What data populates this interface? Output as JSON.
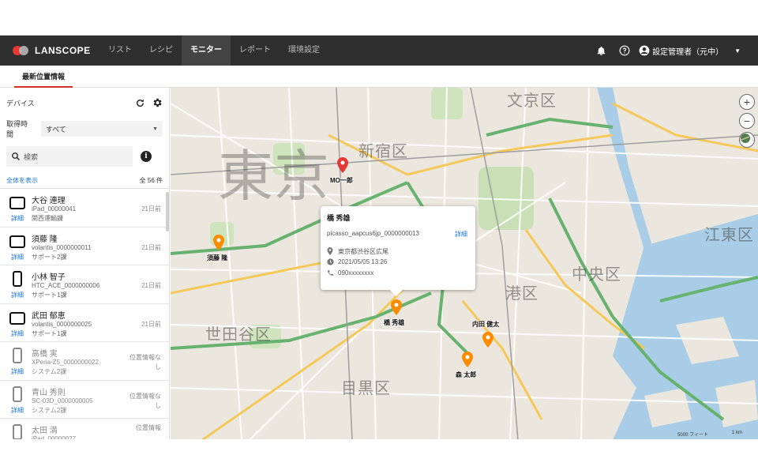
{
  "brand": {
    "name": "LANSCOPE"
  },
  "nav": {
    "items": [
      {
        "label": "リスト",
        "active": false
      },
      {
        "label": "レシピ",
        "active": false
      },
      {
        "label": "モニター",
        "active": true
      },
      {
        "label": "レポート",
        "active": false
      },
      {
        "label": "環境設定",
        "active": false
      }
    ],
    "user_label": "設定管理者（元中）",
    "icons": [
      "bell-icon",
      "help-icon",
      "user-icon"
    ]
  },
  "subtab": {
    "label": "最新位置情報"
  },
  "sidebar": {
    "title": "デバイス",
    "filter_label": "取得時間",
    "filter_value": "すべて",
    "search_placeholder": "検索",
    "show_all": "全体を表示",
    "total": "全 56 件",
    "detail_label": "詳細",
    "devices": [
      {
        "name": "大谷 連理",
        "id": "iPad_00000041",
        "group": "関西運輸課",
        "time": "21日前",
        "type": "tablet"
      },
      {
        "name": "須藤 隆",
        "id": "volantis_0000000011",
        "group": "サポート2課",
        "time": "21日前",
        "type": "tablet"
      },
      {
        "name": "小林 智子",
        "id": "HTC_ACE_0000000006",
        "group": "サポート1課",
        "time": "21日前",
        "type": "phone"
      },
      {
        "name": "武田 郁恵",
        "id": "volantis_0000000025",
        "group": "サポート1課",
        "time": "21日前",
        "type": "tablet"
      },
      {
        "name": "高橋 実",
        "id": "XPeria-Z5_0000000022",
        "group": "システム2課",
        "time": "位置情報なし",
        "type": "phone"
      },
      {
        "name": "青山 秀則",
        "id": "SC-03D_0000000005",
        "group": "システム2課",
        "time": "位置情報なし",
        "type": "phone"
      },
      {
        "name": "太田 満",
        "id": "iPad_00000027",
        "group": "",
        "time": "位置情報",
        "type": "phone"
      }
    ]
  },
  "map": {
    "wards": [
      "東京",
      "新宿区",
      "文京区",
      "江東区",
      "中央区",
      "港区",
      "世田谷区",
      "目黒区"
    ],
    "pins": [
      {
        "label": "MO一郎",
        "color": "#e53935"
      },
      {
        "label": "須藤 隆",
        "color": "#fb8c00"
      },
      {
        "label": "橋 秀雄",
        "color": "#fb8c00"
      },
      {
        "label": "内田 健太",
        "color": "#fb8c00"
      },
      {
        "label": "森 太郎",
        "color": "#fb8c00"
      }
    ],
    "popup": {
      "name": "橋 秀雄",
      "device_id": "picasso_aapcus6jp_0000000013",
      "detail": "詳細",
      "address": "東京都渋谷区広尾",
      "datetime": "2021/05/05 13:26",
      "phone": "090xxxxxxxx"
    },
    "scale": [
      "5000 フィート",
      "1 km"
    ],
    "controls": [
      "zoom-in",
      "zoom-out",
      "layer"
    ]
  },
  "colors": {
    "accent": "#d32f2f",
    "link": "#1976d2",
    "topbar": "#2f2f2f",
    "pin_orange": "#fb8c00",
    "pin_red": "#e53935"
  }
}
